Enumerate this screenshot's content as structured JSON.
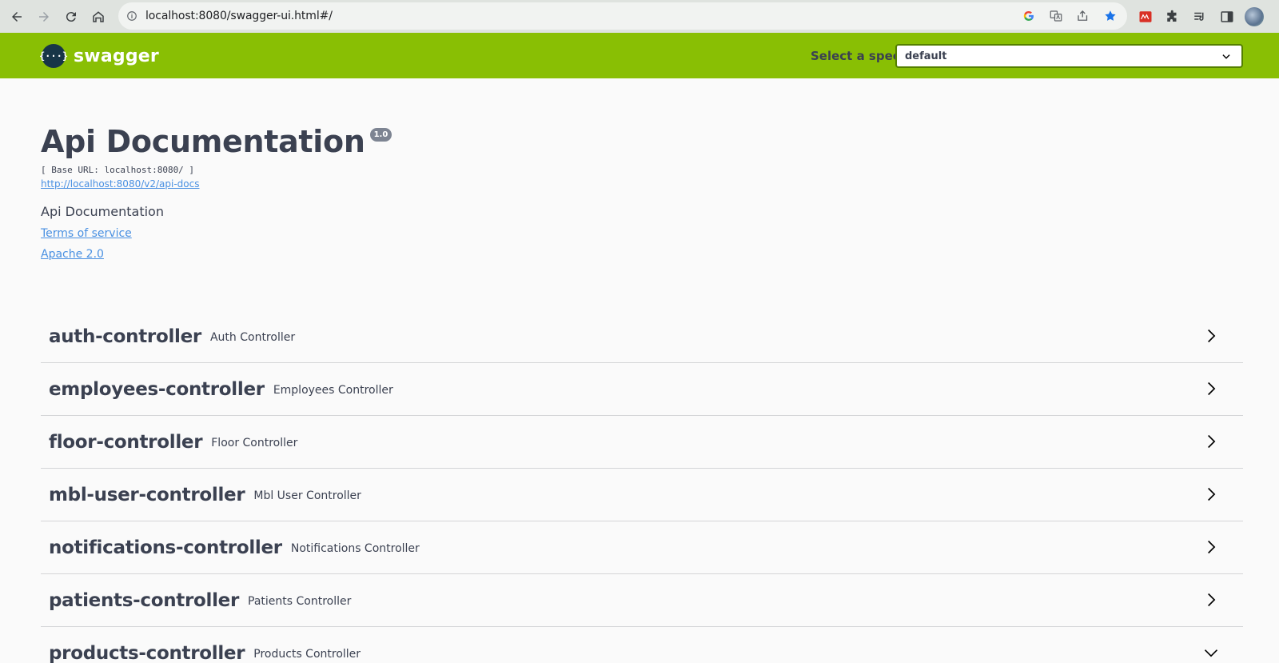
{
  "browser": {
    "url": "localhost:8080/swagger-ui.html#/"
  },
  "topbar": {
    "logo_text": "swagger",
    "logo_badge": "{···}",
    "spec_label": "Select a spec",
    "spec_value": "default"
  },
  "info": {
    "title": "Api Documentation",
    "version": "1.0",
    "base_url": "[ Base URL: localhost:8080/ ]",
    "api_docs_link": "http://localhost:8080/v2/api-docs",
    "description": "Api Documentation",
    "terms_link": "Terms of service",
    "license_link": "Apache 2.0"
  },
  "controllers": [
    {
      "name": "auth-controller",
      "desc": "Auth Controller",
      "expanded": false
    },
    {
      "name": "employees-controller",
      "desc": "Employees Controller",
      "expanded": false
    },
    {
      "name": "floor-controller",
      "desc": "Floor Controller",
      "expanded": false
    },
    {
      "name": "mbl-user-controller",
      "desc": "Mbl User Controller",
      "expanded": false
    },
    {
      "name": "notifications-controller",
      "desc": "Notifications Controller",
      "expanded": false
    },
    {
      "name": "patients-controller",
      "desc": "Patients Controller",
      "expanded": false
    },
    {
      "name": "products-controller",
      "desc": "Products Controller",
      "expanded": true
    }
  ],
  "colors": {
    "topbar": "#89bf04",
    "link": "#4990e2",
    "text": "#3b4151"
  }
}
